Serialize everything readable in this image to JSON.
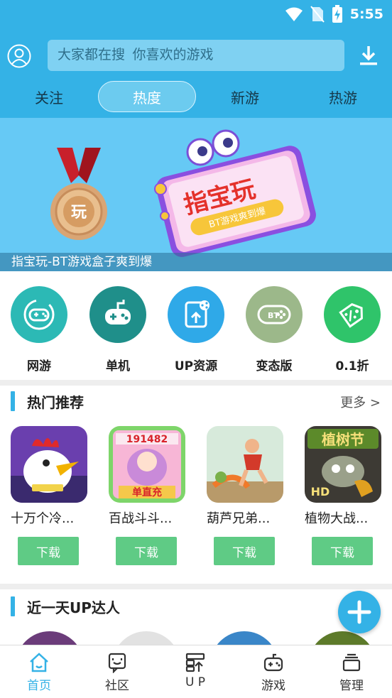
{
  "status_bar": {
    "time": "5:55"
  },
  "header": {
    "search_placeholder": "大家都在搜  你喜欢的游戏",
    "tabs": [
      {
        "label": "关注"
      },
      {
        "label": "热度",
        "active": true
      },
      {
        "label": "新游"
      },
      {
        "label": "热游"
      }
    ]
  },
  "banner": {
    "caption": "指宝玩-BT游戏盒子爽到爆",
    "medal_text": "玩",
    "sign_title": "指宝玩",
    "sign_subtitle": "BT游戏爽到爆"
  },
  "categories": [
    {
      "label": "网游",
      "icon": "gamepad-circle-icon",
      "color": "#2cb9b5"
    },
    {
      "label": "单机",
      "icon": "joystick-icon",
      "color": "#1f8f8a"
    },
    {
      "label": "UP资源",
      "icon": "upload-share-icon",
      "color": "#2fa9e8"
    },
    {
      "label": "变态版",
      "icon": "bt-gamepad-icon",
      "color": "#9cb88a"
    },
    {
      "label": "0.1折",
      "icon": "discount-tag-icon",
      "color": "#2fc46a"
    }
  ],
  "hot": {
    "title": "热门推荐",
    "more": "更多 >",
    "games": [
      {
        "name": "十万个冷...",
        "download": "下载"
      },
      {
        "name": "百战斗斗...",
        "download": "下载",
        "icon_text_top": "191482",
        "icon_text_bottom": "单直充"
      },
      {
        "name": "葫芦兄弟...",
        "download": "下载"
      },
      {
        "name": "植物大战...",
        "download": "下载",
        "icon_text_top": "植树节",
        "icon_text_bottom": "HD"
      }
    ]
  },
  "up_section": {
    "title": "近一天UP达人"
  },
  "bottom_nav": [
    {
      "label": "首页",
      "active": true
    },
    {
      "label": "社区"
    },
    {
      "label": "U P"
    },
    {
      "label": "游戏"
    },
    {
      "label": "管理"
    }
  ],
  "colors": {
    "primary": "#34b2e6",
    "download_green": "#5fcb85"
  }
}
